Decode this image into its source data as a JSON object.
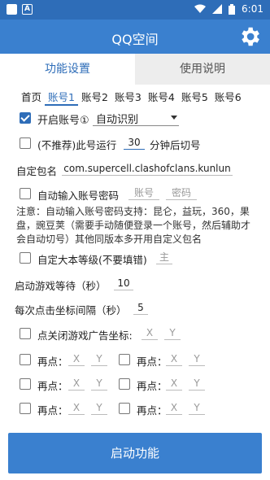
{
  "status": {
    "time": "6:01"
  },
  "appbar": {
    "title": "QQ空间",
    "settings_icon": "gear-icon"
  },
  "tabs": [
    {
      "label": "功能设置"
    },
    {
      "label": "使用说明"
    }
  ],
  "subtabs": [
    "首页",
    "账号1",
    "账号2",
    "账号3",
    "账号4",
    "账号5",
    "账号6"
  ],
  "account": {
    "enable_label": "开启账号①",
    "enable_checked": true,
    "mode_value": "自动识别",
    "switch_prefix": "(不推荐)此号运行",
    "switch_minutes": "30",
    "switch_suffix": "分钟后切号",
    "package_label": "自定包名",
    "package_value": "com.supercell.clashofclans.kunlun",
    "autopw_label": "自动输入账号密码",
    "account_placeholder": "账号",
    "password_placeholder": "密码",
    "note": "注意：自动输入账号密码支持：昆仑，益玩，360，果盘，豌豆荚（需要手动随便登录一个账号，然后辅助才会自动切号）其他同版本多开用自定义包名",
    "level_label": "自定大本等级(不要填错)",
    "level_placeholder": "主",
    "wait_label": "启动游戏等待（秒）",
    "wait_value": "10",
    "interval_label": "每次点击坐标间隔（秒）",
    "interval_value": "5",
    "close_ad_label": "点关闭游戏广告坐标:",
    "x_placeholder": "X",
    "y_placeholder": "Y",
    "again_label": "再点："
  },
  "start_button": "启动功能"
}
